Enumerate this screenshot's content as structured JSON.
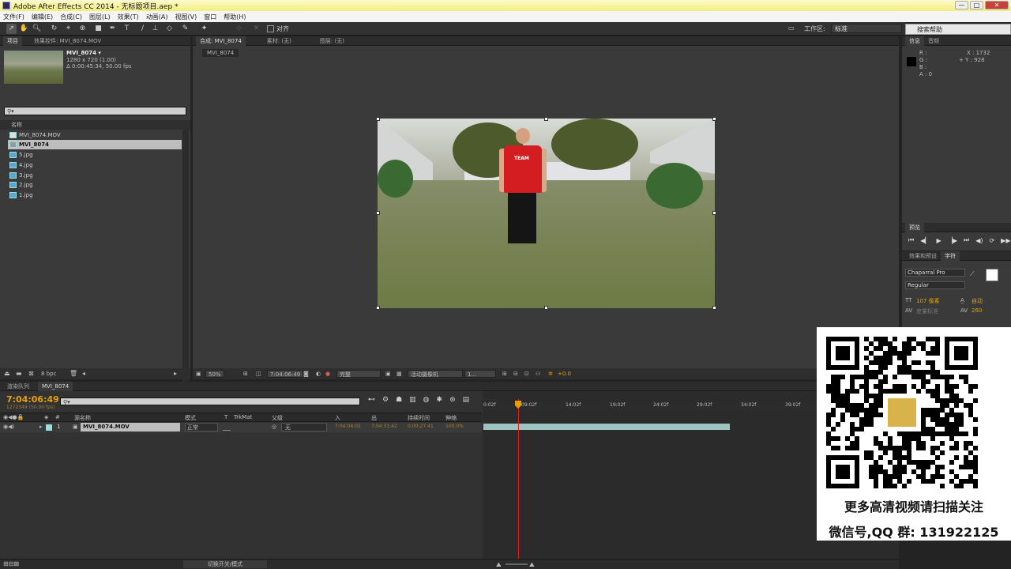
{
  "window": {
    "title": "Adobe After Effects CC 2014 - 无标题项目.aep *",
    "min": "—",
    "max": "□",
    "close": "✕"
  },
  "menu": [
    "文件(F)",
    "编辑(E)",
    "合成(C)",
    "图层(L)",
    "效果(T)",
    "动画(A)",
    "视图(V)",
    "窗口",
    "帮助(H)"
  ],
  "help_search": "搜索帮助",
  "toolbar": {
    "snap_label": "对齐",
    "workspace_label": "工作区:",
    "workspace_value": "标准"
  },
  "project": {
    "tabs": [
      "项目",
      "效果控件: MVI_8074.MOV"
    ],
    "item_name": "MVI_8074 ▾",
    "item_size": "1280 x 720 (1.00)",
    "item_duration": "Δ 0:00:45:34, 50.00 fps",
    "column_name": "名称",
    "items": [
      "MVI_8074.MOV",
      "MVI_8074",
      "5.jpg",
      "4.jpg",
      "3.jpg",
      "2.jpg",
      "1.jpg"
    ],
    "bpc": "8 bpc"
  },
  "composition": {
    "tabs": [
      "合成: MVI_8074",
      "素材: (无)",
      "图层: (无)"
    ],
    "breadcrumb": "MVI_8074",
    "shirt_text": "TEAM",
    "zoom": "50%",
    "timecode": "7:04:06:49",
    "resolution": "完整",
    "camera": "活动摄像机",
    "views": "1...",
    "exposure": "+0.0"
  },
  "info": {
    "tabs": [
      "信息",
      "音频"
    ],
    "r": "R :",
    "g": "G :",
    "b": "B :",
    "a": "A : 0",
    "x": "X : 1732",
    "y": "+ Y : 928"
  },
  "preview": {
    "tab": "预览"
  },
  "character": {
    "tabs": [
      "效果和预设",
      "字符"
    ],
    "font": "Chaparral Pro",
    "style": "Regular",
    "size": "107 像素",
    "leading": "自动",
    "kerning": "度量标准",
    "tracking": "260"
  },
  "timeline": {
    "tabs": [
      "渲染队列",
      "MVI_8074"
    ],
    "timecode": "7:04:06:49",
    "frames": "1272349 (50.00 fps)",
    "headers": [
      "源名称",
      "模式",
      "T",
      "TrkMat",
      "父级",
      "入",
      "出",
      "持续时间",
      "伸缩"
    ],
    "layer": {
      "num": "1",
      "name": "MVI_8074.MOV",
      "mode": "正常",
      "parent": "无",
      "in": "7:04:04:02",
      "out": "7:04:31:42",
      "dur": "0:00:27:41",
      "stretch": "100.0%"
    },
    "ruler": [
      "0:02f",
      "09:02f",
      "14:02f",
      "19:02f",
      "24:02f",
      "29:02f",
      "34:02f",
      "39:02f"
    ],
    "footer": "切换开关/模式",
    "playhead_fraction": 0.083
  },
  "qr_overlay": {
    "line1": "更多高清视频请扫描关注",
    "line2": "微信号,QQ 群: 131922125"
  }
}
